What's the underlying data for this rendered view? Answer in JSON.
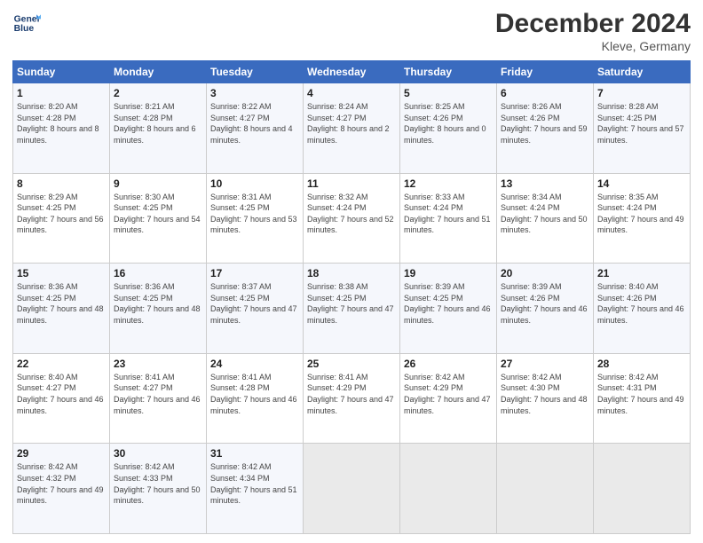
{
  "logo": {
    "line1": "General",
    "line2": "Blue"
  },
  "title": "December 2024",
  "location": "Kleve, Germany",
  "days_of_week": [
    "Sunday",
    "Monday",
    "Tuesday",
    "Wednesday",
    "Thursday",
    "Friday",
    "Saturday"
  ],
  "weeks": [
    [
      {
        "day": "1",
        "sunrise": "8:20 AM",
        "sunset": "4:28 PM",
        "daylight": "8 hours and 8 minutes."
      },
      {
        "day": "2",
        "sunrise": "8:21 AM",
        "sunset": "4:28 PM",
        "daylight": "8 hours and 6 minutes."
      },
      {
        "day": "3",
        "sunrise": "8:22 AM",
        "sunset": "4:27 PM",
        "daylight": "8 hours and 4 minutes."
      },
      {
        "day": "4",
        "sunrise": "8:24 AM",
        "sunset": "4:27 PM",
        "daylight": "8 hours and 2 minutes."
      },
      {
        "day": "5",
        "sunrise": "8:25 AM",
        "sunset": "4:26 PM",
        "daylight": "8 hours and 0 minutes."
      },
      {
        "day": "6",
        "sunrise": "8:26 AM",
        "sunset": "4:26 PM",
        "daylight": "7 hours and 59 minutes."
      },
      {
        "day": "7",
        "sunrise": "8:28 AM",
        "sunset": "4:25 PM",
        "daylight": "7 hours and 57 minutes."
      }
    ],
    [
      {
        "day": "8",
        "sunrise": "8:29 AM",
        "sunset": "4:25 PM",
        "daylight": "7 hours and 56 minutes."
      },
      {
        "day": "9",
        "sunrise": "8:30 AM",
        "sunset": "4:25 PM",
        "daylight": "7 hours and 54 minutes."
      },
      {
        "day": "10",
        "sunrise": "8:31 AM",
        "sunset": "4:25 PM",
        "daylight": "7 hours and 53 minutes."
      },
      {
        "day": "11",
        "sunrise": "8:32 AM",
        "sunset": "4:24 PM",
        "daylight": "7 hours and 52 minutes."
      },
      {
        "day": "12",
        "sunrise": "8:33 AM",
        "sunset": "4:24 PM",
        "daylight": "7 hours and 51 minutes."
      },
      {
        "day": "13",
        "sunrise": "8:34 AM",
        "sunset": "4:24 PM",
        "daylight": "7 hours and 50 minutes."
      },
      {
        "day": "14",
        "sunrise": "8:35 AM",
        "sunset": "4:24 PM",
        "daylight": "7 hours and 49 minutes."
      }
    ],
    [
      {
        "day": "15",
        "sunrise": "8:36 AM",
        "sunset": "4:25 PM",
        "daylight": "7 hours and 48 minutes."
      },
      {
        "day": "16",
        "sunrise": "8:36 AM",
        "sunset": "4:25 PM",
        "daylight": "7 hours and 48 minutes."
      },
      {
        "day": "17",
        "sunrise": "8:37 AM",
        "sunset": "4:25 PM",
        "daylight": "7 hours and 47 minutes."
      },
      {
        "day": "18",
        "sunrise": "8:38 AM",
        "sunset": "4:25 PM",
        "daylight": "7 hours and 47 minutes."
      },
      {
        "day": "19",
        "sunrise": "8:39 AM",
        "sunset": "4:25 PM",
        "daylight": "7 hours and 46 minutes."
      },
      {
        "day": "20",
        "sunrise": "8:39 AM",
        "sunset": "4:26 PM",
        "daylight": "7 hours and 46 minutes."
      },
      {
        "day": "21",
        "sunrise": "8:40 AM",
        "sunset": "4:26 PM",
        "daylight": "7 hours and 46 minutes."
      }
    ],
    [
      {
        "day": "22",
        "sunrise": "8:40 AM",
        "sunset": "4:27 PM",
        "daylight": "7 hours and 46 minutes."
      },
      {
        "day": "23",
        "sunrise": "8:41 AM",
        "sunset": "4:27 PM",
        "daylight": "7 hours and 46 minutes."
      },
      {
        "day": "24",
        "sunrise": "8:41 AM",
        "sunset": "4:28 PM",
        "daylight": "7 hours and 46 minutes."
      },
      {
        "day": "25",
        "sunrise": "8:41 AM",
        "sunset": "4:29 PM",
        "daylight": "7 hours and 47 minutes."
      },
      {
        "day": "26",
        "sunrise": "8:42 AM",
        "sunset": "4:29 PM",
        "daylight": "7 hours and 47 minutes."
      },
      {
        "day": "27",
        "sunrise": "8:42 AM",
        "sunset": "4:30 PM",
        "daylight": "7 hours and 48 minutes."
      },
      {
        "day": "28",
        "sunrise": "8:42 AM",
        "sunset": "4:31 PM",
        "daylight": "7 hours and 49 minutes."
      }
    ],
    [
      {
        "day": "29",
        "sunrise": "8:42 AM",
        "sunset": "4:32 PM",
        "daylight": "7 hours and 49 minutes."
      },
      {
        "day": "30",
        "sunrise": "8:42 AM",
        "sunset": "4:33 PM",
        "daylight": "7 hours and 50 minutes."
      },
      {
        "day": "31",
        "sunrise": "8:42 AM",
        "sunset": "4:34 PM",
        "daylight": "7 hours and 51 minutes."
      },
      null,
      null,
      null,
      null
    ]
  ]
}
